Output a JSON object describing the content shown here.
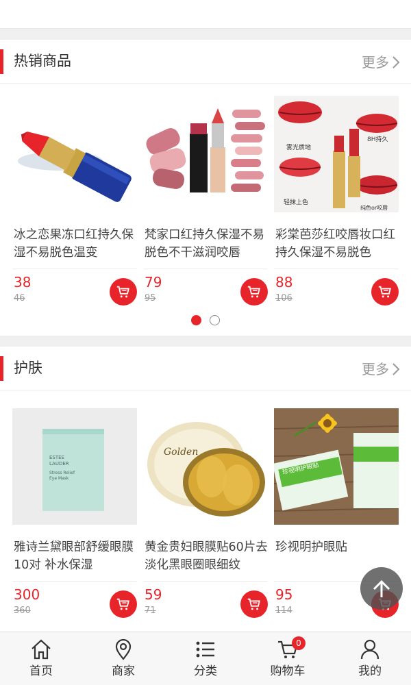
{
  "sections": [
    {
      "title": "热销商品",
      "more": "更多",
      "products": [
        {
          "name": "冰之恋果冻口红持久保湿不易脱色温变",
          "price": "38",
          "old_price": "46"
        },
        {
          "name": "梵家口红持久保湿不易脱色不干滋润咬唇",
          "price": "79",
          "old_price": "95"
        },
        {
          "name": "彩棠芭莎红咬唇妆口红持久保湿不易脱色",
          "price": "88",
          "old_price": "106"
        }
      ],
      "carousel_pages": 2,
      "carousel_active": 1
    },
    {
      "title": "护肤",
      "more": "更多",
      "products": [
        {
          "name": "雅诗兰黛眼部舒缓眼膜10对 补水保湿",
          "price": "300",
          "old_price": "360"
        },
        {
          "name": "黄金贵妇眼膜贴60片去淡化黑眼圈眼细纹",
          "price": "59",
          "old_price": "71"
        },
        {
          "name": "珍视明护眼贴",
          "price": "95",
          "old_price": "114"
        }
      ]
    }
  ],
  "image_texts": {
    "lipstick3_labels": [
      "雾光质地",
      "8H持久",
      "轻抹上色",
      "纯色or咬唇"
    ],
    "mask1_box": [
      "ESTEE",
      "LAUDER",
      "Stress Relief",
      "Eye Mask"
    ],
    "mask2_jar": "Golden",
    "mask3_box": "珍视明护眼贴"
  },
  "tabbar": {
    "tabs": [
      {
        "label": "首页",
        "icon": "home-icon"
      },
      {
        "label": "商家",
        "icon": "location-pin-icon"
      },
      {
        "label": "分类",
        "icon": "list-icon"
      },
      {
        "label": "购物车",
        "icon": "cart-icon",
        "badge": "0"
      },
      {
        "label": "我的",
        "icon": "user-icon"
      }
    ]
  },
  "colors": {
    "accent": "#e8242b",
    "text": "#333333",
    "muted": "#999999",
    "background": "#f0f0f0"
  }
}
